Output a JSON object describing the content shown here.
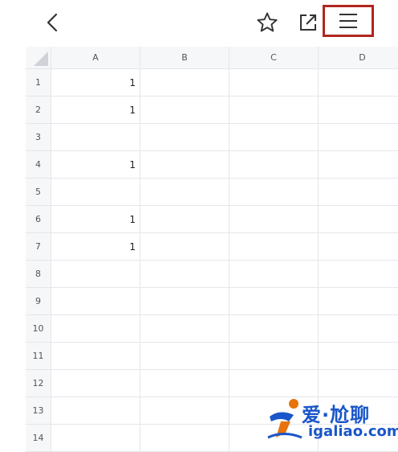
{
  "toolbar": {
    "back_icon": "chevron-left-icon",
    "star_icon": "star-outline-icon",
    "share_icon": "external-link-icon",
    "menu_icon": "hamburger-menu-icon",
    "menu_highlight_color": "#b0261e"
  },
  "sheet": {
    "columns": [
      "A",
      "B",
      "C",
      "D"
    ],
    "rows": [
      {
        "num": "1",
        "a": "1"
      },
      {
        "num": "2",
        "a": "1"
      },
      {
        "num": "3",
        "a": ""
      },
      {
        "num": "4",
        "a": "1"
      },
      {
        "num": "5",
        "a": ""
      },
      {
        "num": "6",
        "a": "1"
      },
      {
        "num": "7",
        "a": "1"
      },
      {
        "num": "8",
        "a": ""
      },
      {
        "num": "9",
        "a": ""
      },
      {
        "num": "10",
        "a": ""
      },
      {
        "num": "11",
        "a": ""
      },
      {
        "num": "12",
        "a": ""
      },
      {
        "num": "13",
        "a": ""
      },
      {
        "num": "14",
        "a": ""
      }
    ]
  },
  "watermark": {
    "title": "爱·尬聊",
    "domain": "igaliao.com",
    "color": "#1a56c9"
  }
}
